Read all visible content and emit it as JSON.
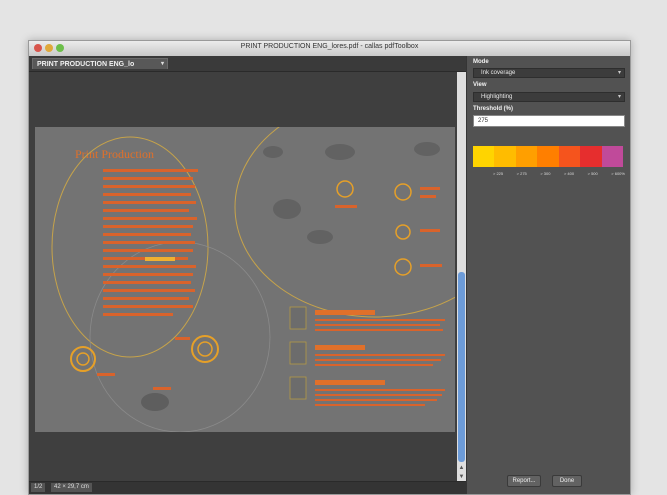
{
  "window": {
    "title": "PRINT PRODUCTION ENG_lores.pdf - callas pdfToolbox"
  },
  "tab": {
    "label": "PRINT PRODUCTION ENG_lo",
    "arrow": "▾"
  },
  "document": {
    "heading": "Print Production"
  },
  "status": {
    "pages": "1/2",
    "size": "42 × 29,7 cm"
  },
  "panel": {
    "mode_label": "Mode",
    "mode_value": "Ink coverage",
    "view_label": "View",
    "view_value": "Highlighting",
    "threshold_label": "Threshold (%)",
    "threshold_value": "275",
    "swatches": [
      "#ffd400",
      "#ffbc00",
      "#ff9f00",
      "#ff7f00",
      "#f5541d",
      "#e62e2e",
      "#c04a9a"
    ],
    "legend": [
      "> 225",
      "> 275",
      "> 300",
      "> 400",
      "> 500",
      "> 600%"
    ],
    "report_button": "Report...",
    "done_button": "Done"
  }
}
